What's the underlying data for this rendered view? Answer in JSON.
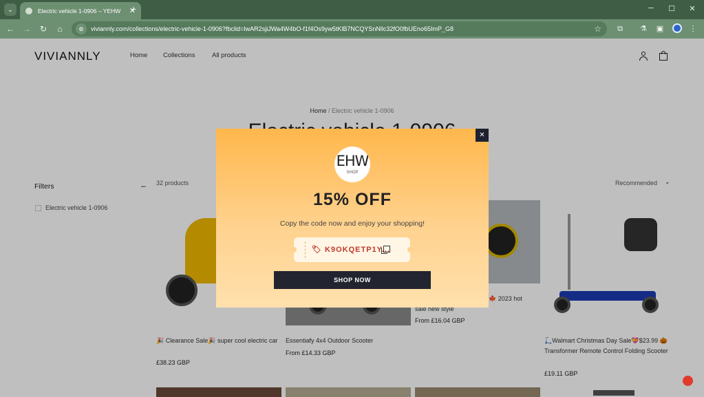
{
  "browser": {
    "tab_title": "Electric vehicle 1-0906 – YEHW",
    "url": "viviannly.com/collections/electric-vehicle-1-0906?fbclid=IwAR2sjiJWa4W4bO-f1f4Os9yw5tKlB7NCQYSnNllc32fO0fbUEno65ImP_G8",
    "icons": {
      "tab_menu": "chevron-down-icon",
      "close": "✕",
      "new_tab": "+",
      "minimize": "─",
      "maximize": "☐",
      "window_close": "✕",
      "back": "←",
      "forward": "→",
      "reload": "↻",
      "home": "⌂",
      "site_info": "⚙",
      "star": "☆",
      "extension": "⧉",
      "lab": "⚗",
      "sidebar": "▣",
      "more": "⋮"
    }
  },
  "store": {
    "logo": "VIVIANNLY",
    "nav": [
      "Home",
      "Collections",
      "All products"
    ],
    "breadcrumb": {
      "home": "Home",
      "separator": " / ",
      "current": "Electric vehicle 1-0906"
    },
    "collection_title": "Electric vehicle 1-0906",
    "filters": {
      "title": "Filters",
      "toggle": "–",
      "options": [
        "Electric vehicle 1-0906"
      ]
    },
    "products_count": "32 products",
    "sort": {
      "label": "Recommended",
      "chevron": "⌄"
    },
    "products": [
      {
        "title": "🎉 Clearance Sale🎉 super cool electric car",
        "price": "£38.23 GBP"
      },
      {
        "title": "Essentiafy 4x4 Outdoor Scooter",
        "price": "From £14.33 GBP"
      },
      {
        "title_fragment": "🍁 2023 hot",
        "title": "sale new style",
        "price": "From £16.04 GBP"
      },
      {
        "title": "🛴Walmart Christmas Day Sale💝$23.99 🎃 Transformer Remote Control Folding Scooter",
        "price": "£19.11 GBP"
      }
    ]
  },
  "popup": {
    "close": "✕",
    "logo_text": "EHW",
    "logo_sub": "SHOP",
    "headline": "15% OFF",
    "subtitle": "Copy the code now and enjoy your shopping!",
    "coupon_code": "🏷 K9OKQETP1Y...",
    "button_label": "SHOP NOW"
  },
  "colors": {
    "tabbar": "#3f5d45",
    "toolbar": "#6d8f72",
    "popup_top": "#ffb74c",
    "popup_bottom": "#ffe0ad",
    "coupon_text": "#c0392b",
    "button": "#22252f"
  }
}
